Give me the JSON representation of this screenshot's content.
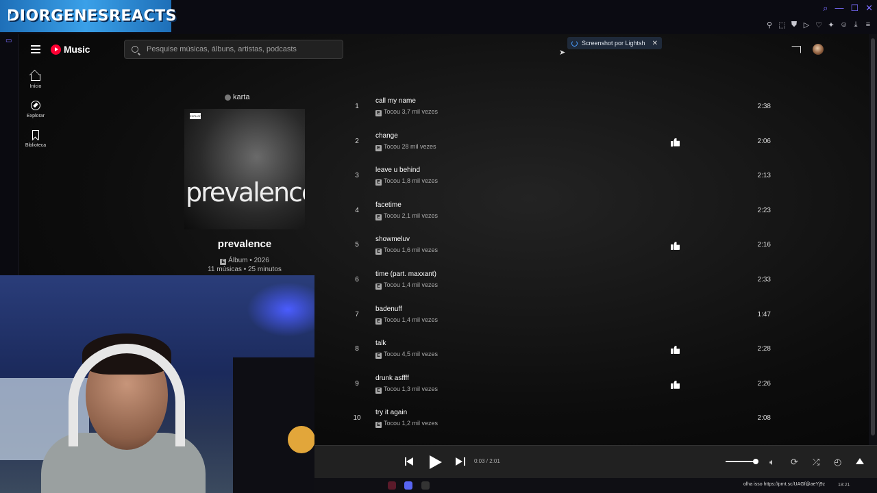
{
  "stream": {
    "channel_name": "DIORGENESREACTS"
  },
  "header": {
    "logo_text": "Music",
    "search_placeholder": "Pesquise músicas, álbuns, artistas, podcasts",
    "toast_text": "Screenshot por Lightsh",
    "toast_close": "✕"
  },
  "nav": [
    {
      "label": "Início",
      "icon": "home-icon"
    },
    {
      "label": "Explorar",
      "icon": "explore-icon"
    },
    {
      "label": "Biblioteca",
      "icon": "library-icon"
    }
  ],
  "album": {
    "artist": "karta",
    "cover_word": "prevalence",
    "title": "prevalence",
    "type_line": "Álbum • 2026",
    "stats_line": "11 músicas • 25 minutos"
  },
  "tracks": [
    {
      "num": "1",
      "title": "call my name",
      "plays": "Tocou 3,7 mil vezes",
      "liked": false,
      "duration": "2:38"
    },
    {
      "num": "2",
      "title": "change",
      "plays": "Tocou 28 mil vezes",
      "liked": true,
      "duration": "2:06"
    },
    {
      "num": "3",
      "title": "leave u behind",
      "plays": "Tocou 1,8 mil vezes",
      "liked": false,
      "duration": "2:13"
    },
    {
      "num": "4",
      "title": "facetime",
      "plays": "Tocou 2,1 mil vezes",
      "liked": false,
      "duration": "2:23"
    },
    {
      "num": "5",
      "title": "showmeluv",
      "plays": "Tocou 1,6 mil vezes",
      "liked": true,
      "duration": "2:16"
    },
    {
      "num": "6",
      "title": "time (part. maxxant)",
      "plays": "Tocou 1,4 mil vezes",
      "liked": false,
      "duration": "2:33"
    },
    {
      "num": "7",
      "title": "badenuff",
      "plays": "Tocou 1,4 mil vezes",
      "liked": false,
      "duration": "1:47"
    },
    {
      "num": "8",
      "title": "talk",
      "plays": "Tocou 4,5 mil vezes",
      "liked": true,
      "duration": "2:28"
    },
    {
      "num": "9",
      "title": "drunk asffff",
      "plays": "Tocou 1,3 mil vezes",
      "liked": true,
      "duration": "2:26"
    },
    {
      "num": "10",
      "title": "try it again",
      "plays": "Tocou 1,2 mil vezes",
      "liked": false,
      "duration": "2:08"
    }
  ],
  "player": {
    "time": "0:03 / 2:01",
    "volume_level": 1.0
  },
  "taskbar": {
    "status_text": "olha isso https://prnt.sc/UAGf@aeYj9z",
    "clock": "18:21"
  },
  "colors": {
    "brand_red": "#ff0033",
    "background": "#030303",
    "banner_blue": "#3aa0e8"
  }
}
